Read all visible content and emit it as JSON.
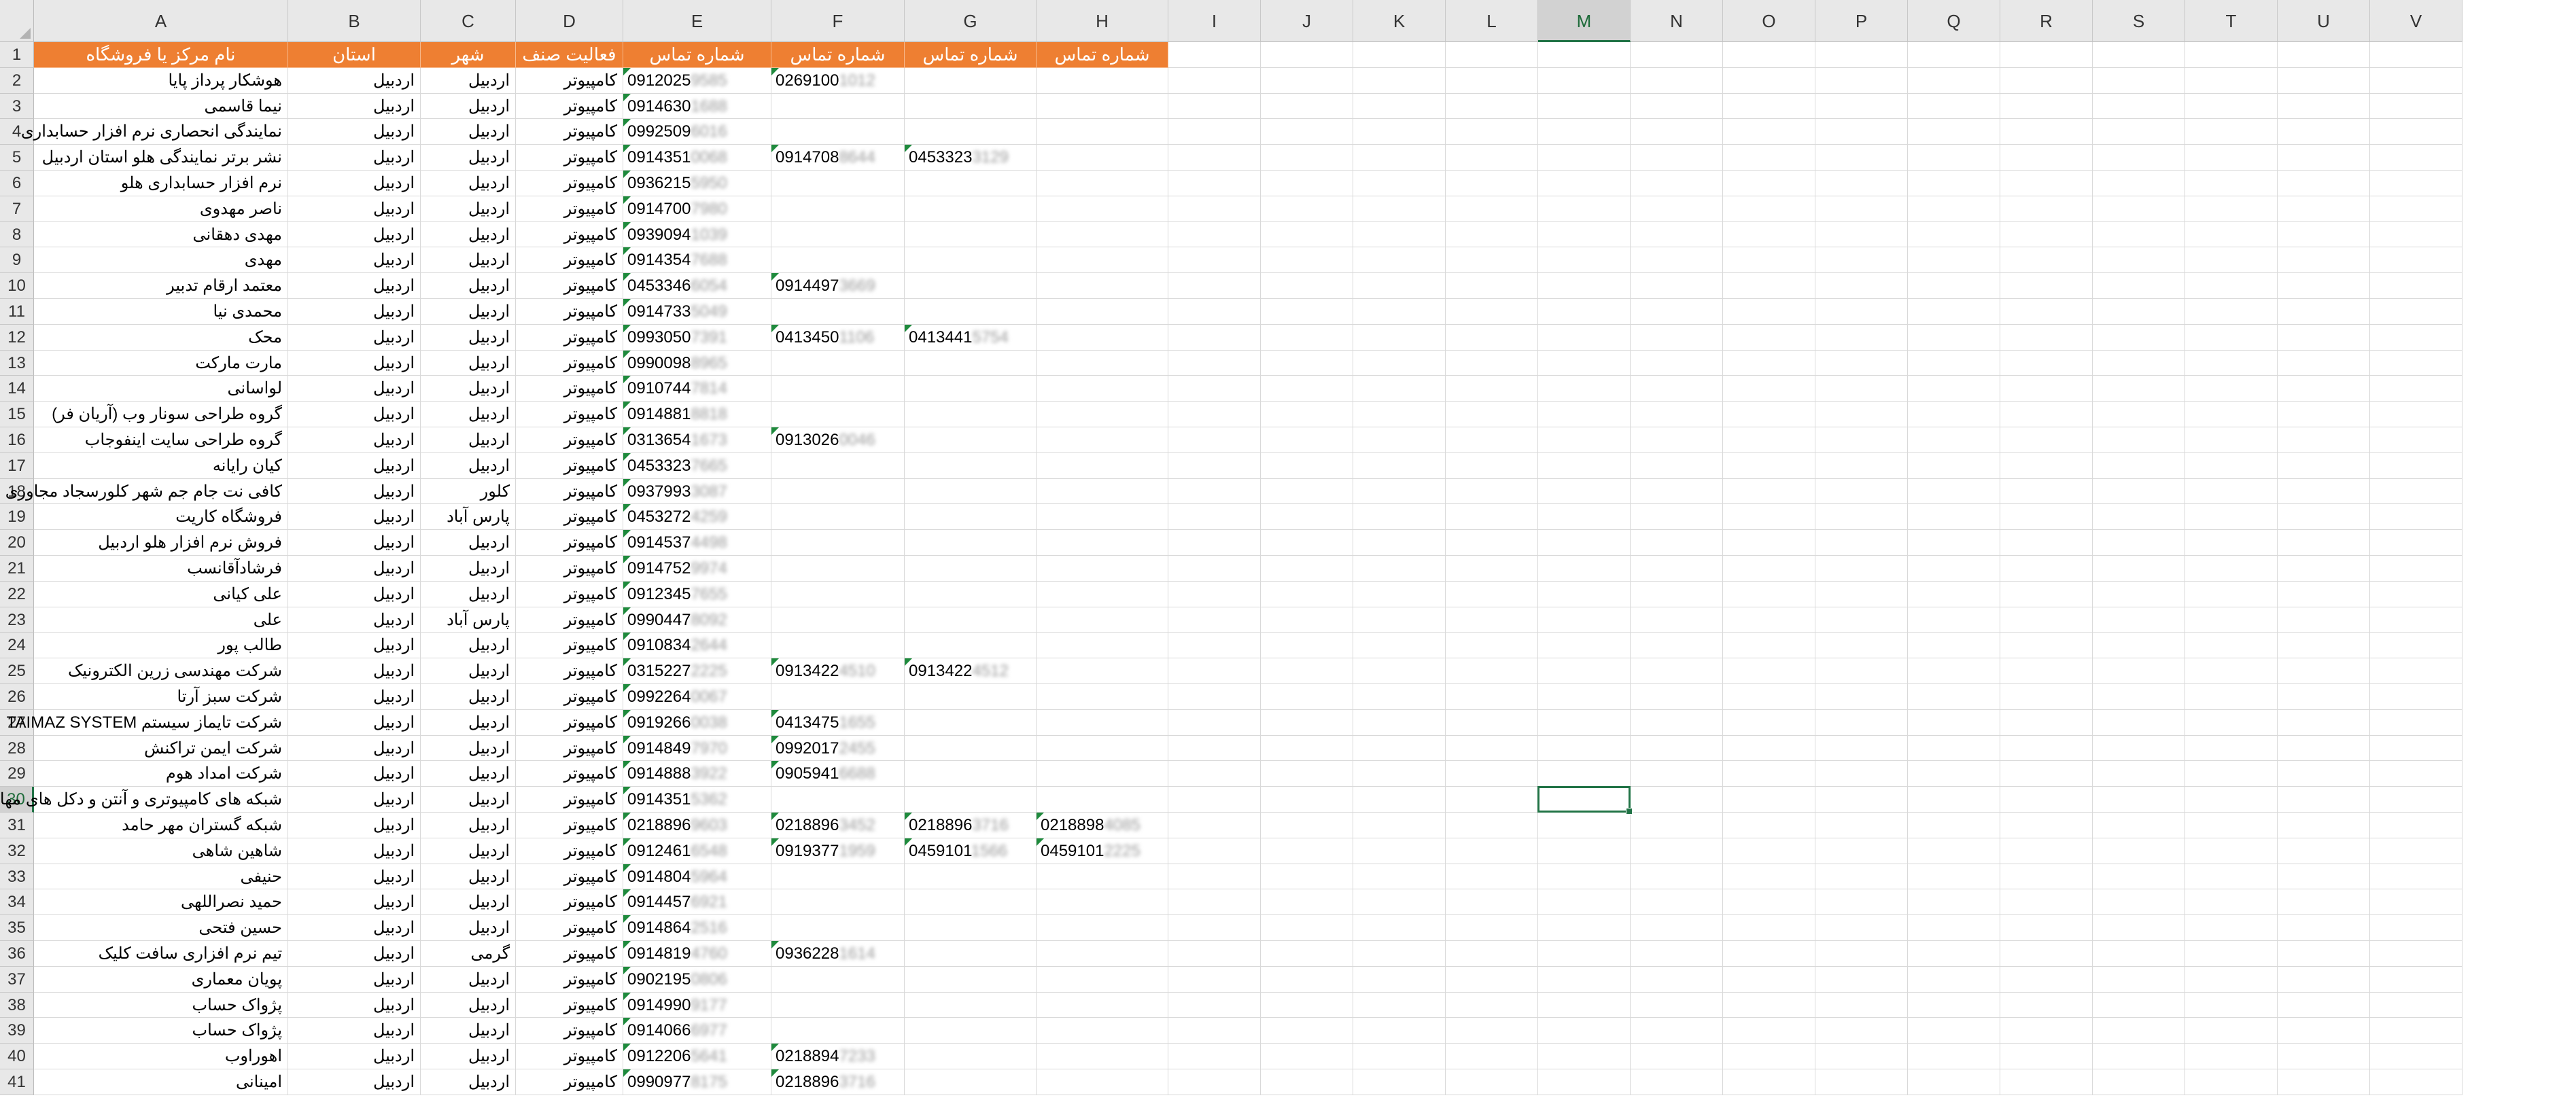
{
  "columns": [
    "A",
    "B",
    "C",
    "D",
    "E",
    "F",
    "G",
    "H",
    "I",
    "J",
    "K",
    "L",
    "M",
    "N",
    "O",
    "P",
    "Q",
    "R",
    "S",
    "T",
    "U",
    "V"
  ],
  "selected_column": "M",
  "selected_row": "30",
  "header_row": {
    "row": "1",
    "cells": [
      "نام مرکز یا فروشگاه",
      "استان",
      "شهر",
      "فعالیت صنف",
      "شماره تماس",
      "شماره تماس",
      "شماره تماس",
      "شماره تماس"
    ]
  },
  "rows": [
    {
      "row": "2",
      "name": "هوشکار پرداز پایا",
      "province": "اردبیل",
      "city": "اردبیل",
      "activity": "کامپیوتر",
      "phones": [
        {
          "visible": "0912025",
          "hidden": "9585"
        },
        {
          "visible": "0269100",
          "hidden": "1012"
        }
      ]
    },
    {
      "row": "3",
      "name": "نیما قاسمی",
      "province": "اردبیل",
      "city": "اردبیل",
      "activity": "کامپیوتر",
      "phones": [
        {
          "visible": "0914630",
          "hidden": "1688"
        }
      ]
    },
    {
      "row": "4",
      "name": "نمایندگی انحصاری نرم افزار حسابداری",
      "province": "اردبیل",
      "city": "اردبیل",
      "activity": "کامپیوتر",
      "phones": [
        {
          "visible": "0992509",
          "hidden": "6016"
        }
      ]
    },
    {
      "row": "5",
      "name": "نشر برتر نمایندگی هلو استان اردبیل",
      "province": "اردبیل",
      "city": "اردبیل",
      "activity": "کامپیوتر",
      "phones": [
        {
          "visible": "0914351",
          "hidden": "0068"
        },
        {
          "visible": "0914708",
          "hidden": "8644"
        },
        {
          "visible": "0453323",
          "hidden": "3129"
        }
      ]
    },
    {
      "row": "6",
      "name": "نرم افزار حسابداری هلو",
      "province": "اردبیل",
      "city": "اردبیل",
      "activity": "کامپیوتر",
      "phones": [
        {
          "visible": "0936215",
          "hidden": "5950"
        }
      ]
    },
    {
      "row": "7",
      "name": "ناصر مهدوی",
      "province": "اردبیل",
      "city": "اردبیل",
      "activity": "کامپیوتر",
      "phones": [
        {
          "visible": "0914700",
          "hidden": "7980"
        }
      ]
    },
    {
      "row": "8",
      "name": "مهدی دهقانی",
      "province": "اردبیل",
      "city": "اردبیل",
      "activity": "کامپیوتر",
      "phones": [
        {
          "visible": "0939094",
          "hidden": "1039"
        }
      ]
    },
    {
      "row": "9",
      "name": "مهدی",
      "province": "اردبیل",
      "city": "اردبیل",
      "activity": "کامپیوتر",
      "phones": [
        {
          "visible": "0914354",
          "hidden": "7688"
        }
      ]
    },
    {
      "row": "10",
      "name": "معتمد ارقام تدبیر",
      "province": "اردبیل",
      "city": "اردبیل",
      "activity": "کامپیوتر",
      "phones": [
        {
          "visible": "0453346",
          "hidden": "6054"
        },
        {
          "visible": "0914497",
          "hidden": "3669"
        }
      ]
    },
    {
      "row": "11",
      "name": "محمدی نیا",
      "province": "اردبیل",
      "city": "اردبیل",
      "activity": "کامپیوتر",
      "phones": [
        {
          "visible": "0914733",
          "hidden": "5049"
        }
      ]
    },
    {
      "row": "12",
      "name": "محک",
      "province": "اردبیل",
      "city": "اردبیل",
      "activity": "کامپیوتر",
      "phones": [
        {
          "visible": "0993050",
          "hidden": "7391"
        },
        {
          "visible": "0413450",
          "hidden": "1106"
        },
        {
          "visible": "0413441",
          "hidden": "5754"
        }
      ]
    },
    {
      "row": "13",
      "name": "مارت مارکت",
      "province": "اردبیل",
      "city": "اردبیل",
      "activity": "کامپیوتر",
      "phones": [
        {
          "visible": "0990098",
          "hidden": "8965"
        }
      ]
    },
    {
      "row": "14",
      "name": "لواسانی",
      "province": "اردبیل",
      "city": "اردبیل",
      "activity": "کامپیوتر",
      "phones": [
        {
          "visible": "0910744",
          "hidden": "7814"
        }
      ]
    },
    {
      "row": "15",
      "name": "گروه طراحی سونار وب (آریان فر)",
      "province": "اردبیل",
      "city": "اردبیل",
      "activity": "کامپیوتر",
      "phones": [
        {
          "visible": "0914881",
          "hidden": "8818"
        }
      ]
    },
    {
      "row": "16",
      "name": "گروه طراحی سایت اینفوجاب",
      "province": "اردبیل",
      "city": "اردبیل",
      "activity": "کامپیوتر",
      "phones": [
        {
          "visible": "0313654",
          "hidden": "1673"
        },
        {
          "visible": "0913026",
          "hidden": "0046"
        }
      ]
    },
    {
      "row": "17",
      "name": "کیان رایانه",
      "province": "اردبیل",
      "city": "اردبیل",
      "activity": "کامپیوتر",
      "phones": [
        {
          "visible": "0453323",
          "hidden": "7665"
        }
      ]
    },
    {
      "row": "18",
      "name": "کافی نت جام جم شهر کلورسجاد مجاوری",
      "province": "اردبیل",
      "city": "کلور",
      "activity": "کامپیوتر",
      "phones": [
        {
          "visible": "0937993",
          "hidden": "3087"
        }
      ]
    },
    {
      "row": "19",
      "name": "فروشگاه کاریت",
      "province": "اردبیل",
      "city": "پارس آباد",
      "activity": "کامپیوتر",
      "phones": [
        {
          "visible": "0453272",
          "hidden": "4259"
        }
      ]
    },
    {
      "row": "20",
      "name": "فروش نرم افزار هلو اردبیل",
      "province": "اردبیل",
      "city": "اردبیل",
      "activity": "کامپیوتر",
      "phones": [
        {
          "visible": "0914537",
          "hidden": "4498"
        }
      ]
    },
    {
      "row": "21",
      "name": "فرشادآقانسب",
      "province": "اردبیل",
      "city": "اردبیل",
      "activity": "کامپیوتر",
      "phones": [
        {
          "visible": "0914752",
          "hidden": "9974"
        }
      ]
    },
    {
      "row": "22",
      "name": "علی کیانی",
      "province": "اردبیل",
      "city": "اردبیل",
      "activity": "کامپیوتر",
      "phones": [
        {
          "visible": "0912345",
          "hidden": "7655"
        }
      ]
    },
    {
      "row": "23",
      "name": "علی",
      "province": "اردبیل",
      "city": "پارس آباد",
      "activity": "کامپیوتر",
      "phones": [
        {
          "visible": "0990447",
          "hidden": "8092"
        }
      ]
    },
    {
      "row": "24",
      "name": "طالب پور",
      "province": "اردبیل",
      "city": "اردبیل",
      "activity": "کامپیوتر",
      "phones": [
        {
          "visible": "0910834",
          "hidden": "2644"
        }
      ]
    },
    {
      "row": "25",
      "name": "شرکت مهندسی زرین الکترونیک",
      "province": "اردبیل",
      "city": "اردبیل",
      "activity": "کامپیوتر",
      "phones": [
        {
          "visible": "0315227",
          "hidden": "2225"
        },
        {
          "visible": "0913422",
          "hidden": "4510"
        },
        {
          "visible": "0913422",
          "hidden": "4512"
        }
      ]
    },
    {
      "row": "26",
      "name": "شرکت سبز آرتا",
      "province": "اردبیل",
      "city": "اردبیل",
      "activity": "کامپیوتر",
      "phones": [
        {
          "visible": "0992264",
          "hidden": "0067"
        }
      ]
    },
    {
      "row": "27",
      "name": "شرکت تایماز سیستم TAIMAZ SYSTEM",
      "province": "اردبیل",
      "city": "اردبیل",
      "activity": "کامپیوتر",
      "phones": [
        {
          "visible": "0919266",
          "hidden": "0038"
        },
        {
          "visible": "0413475",
          "hidden": "1655"
        }
      ]
    },
    {
      "row": "28",
      "name": "شرکت ایمن تراکنش",
      "province": "اردبیل",
      "city": "اردبیل",
      "activity": "کامپیوتر",
      "phones": [
        {
          "visible": "0914849",
          "hidden": "7970"
        },
        {
          "visible": "0992017",
          "hidden": "2455"
        }
      ]
    },
    {
      "row": "29",
      "name": "شرکت امداد هوم",
      "province": "اردبیل",
      "city": "اردبیل",
      "activity": "کامپیوتر",
      "phones": [
        {
          "visible": "0914888",
          "hidden": "3922"
        },
        {
          "visible": "0905941",
          "hidden": "6688"
        }
      ]
    },
    {
      "row": "30",
      "name": "شبکه های کامپیوتری و آنتن و دکل های مهار",
      "province": "اردبیل",
      "city": "اردبیل",
      "activity": "کامپیوتر",
      "phones": [
        {
          "visible": "0914351",
          "hidden": "5362"
        }
      ]
    },
    {
      "row": "31",
      "name": "شبکه گستران مهر حامد",
      "province": "اردبیل",
      "city": "اردبیل",
      "activity": "کامپیوتر",
      "phones": [
        {
          "visible": "0218896",
          "hidden": "9603"
        },
        {
          "visible": "0218896",
          "hidden": "3452"
        },
        {
          "visible": "0218896",
          "hidden": "3716"
        },
        {
          "visible": "0218898",
          "hidden": "4085"
        }
      ]
    },
    {
      "row": "32",
      "name": "شاهین شاهی",
      "province": "اردبیل",
      "city": "اردبیل",
      "activity": "کامپیوتر",
      "phones": [
        {
          "visible": "0912461",
          "hidden": "6548"
        },
        {
          "visible": "0919377",
          "hidden": "1959"
        },
        {
          "visible": "0459101",
          "hidden": "1566"
        },
        {
          "visible": "0459101",
          "hidden": "2225"
        }
      ]
    },
    {
      "row": "33",
      "name": "حنیفی",
      "province": "اردبیل",
      "city": "اردبیل",
      "activity": "کامپیوتر",
      "phones": [
        {
          "visible": "0914804",
          "hidden": "5964"
        }
      ]
    },
    {
      "row": "34",
      "name": "حمید نصراللهی",
      "province": "اردبیل",
      "city": "اردبیل",
      "activity": "کامپیوتر",
      "phones": [
        {
          "visible": "0914457",
          "hidden": "6921"
        }
      ]
    },
    {
      "row": "35",
      "name": "حسین فتحی",
      "province": "اردبیل",
      "city": "اردبیل",
      "activity": "کامپیوتر",
      "phones": [
        {
          "visible": "0914864",
          "hidden": "2516"
        }
      ]
    },
    {
      "row": "36",
      "name": "تیم نرم افزاری سافت کلیک",
      "province": "اردبیل",
      "city": "گرمی",
      "activity": "کامپیوتر",
      "phones": [
        {
          "visible": "0914819",
          "hidden": "4760"
        },
        {
          "visible": "0936228",
          "hidden": "1614"
        }
      ]
    },
    {
      "row": "37",
      "name": "پویان معماری",
      "province": "اردبیل",
      "city": "اردبیل",
      "activity": "کامپیوتر",
      "phones": [
        {
          "visible": "0902195",
          "hidden": "0806"
        }
      ]
    },
    {
      "row": "38",
      "name": "پژواک حساب",
      "province": "اردبیل",
      "city": "اردبیل",
      "activity": "کامپیوتر",
      "phones": [
        {
          "visible": "0914990",
          "hidden": "9177"
        }
      ]
    },
    {
      "row": "39",
      "name": "پژواک حساب",
      "province": "اردبیل",
      "city": "اردبیل",
      "activity": "کامپیوتر",
      "phones": [
        {
          "visible": "0914066",
          "hidden": "6977"
        }
      ]
    },
    {
      "row": "40",
      "name": "اهوراوب",
      "province": "اردبیل",
      "city": "اردبیل",
      "activity": "کامپیوتر",
      "phones": [
        {
          "visible": "0912206",
          "hidden": "5641"
        },
        {
          "visible": "0218894",
          "hidden": "7233"
        }
      ]
    },
    {
      "row": "41",
      "name": "امینانی",
      "province": "اردبیل",
      "city": "اردبیل",
      "activity": "کامپیوتر",
      "phones": [
        {
          "visible": "0990977",
          "hidden": "8175"
        },
        {
          "visible": "0218896",
          "hidden": "3716"
        }
      ]
    }
  ],
  "colors": {
    "header_fill": "#ee7f32",
    "header_text": "#ffffff",
    "grid": "#d9d9d9",
    "selection": "#217346",
    "error_triangle": "#1e8a3c"
  }
}
